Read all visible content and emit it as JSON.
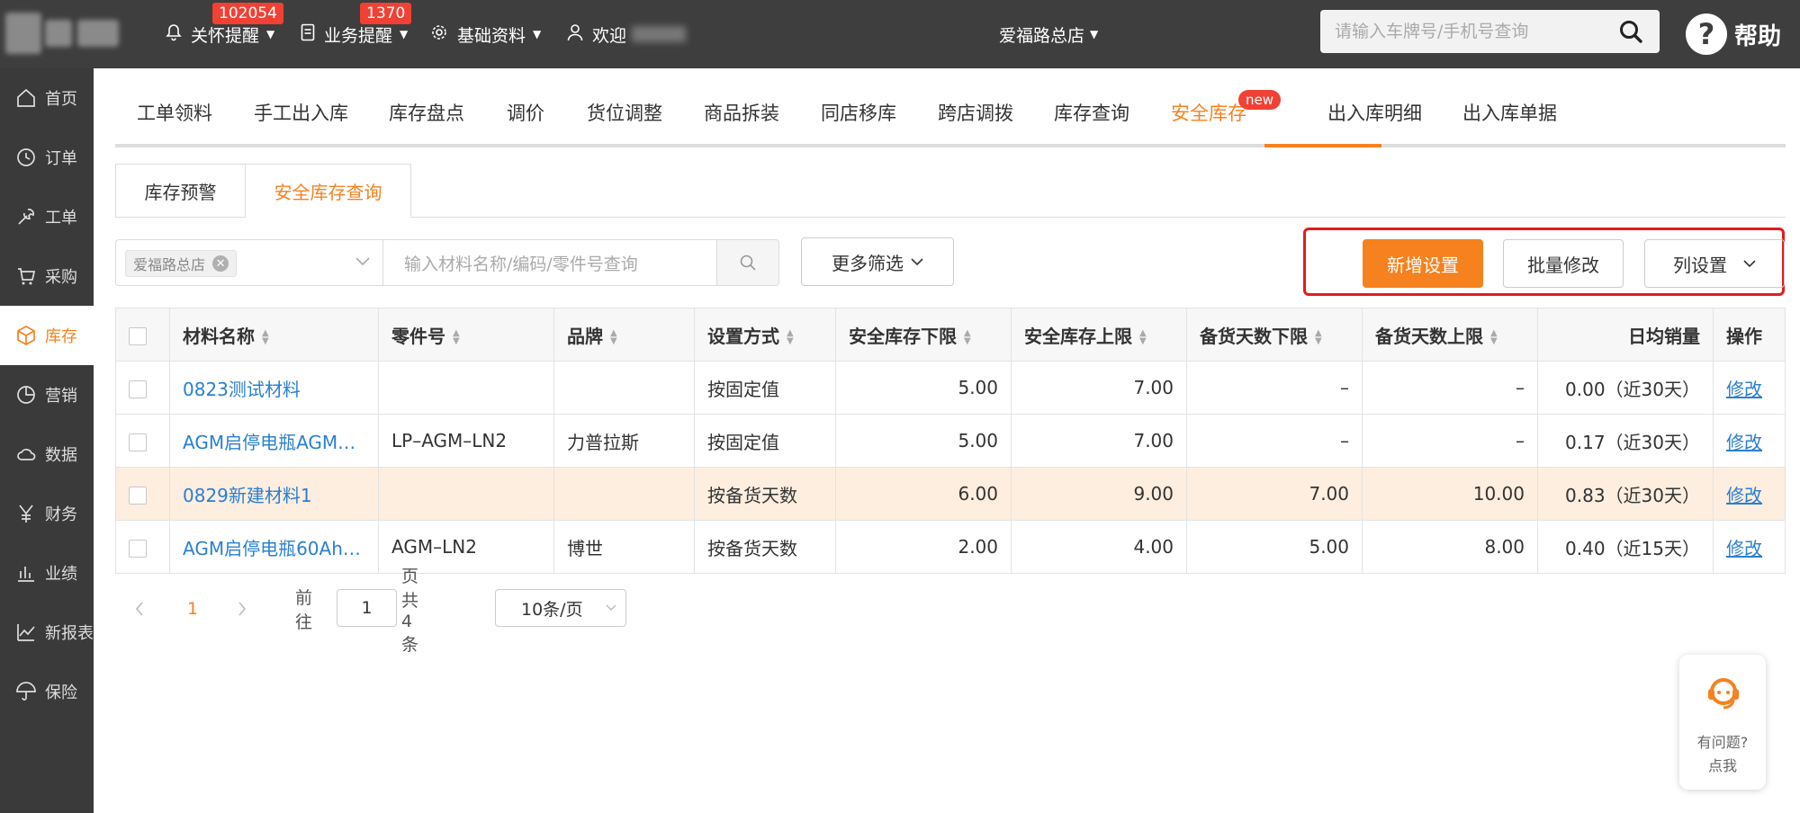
{
  "topbar": {
    "nav": [
      {
        "label": "关怀提醒",
        "badge": "102054"
      },
      {
        "label": "业务提醒",
        "badge": "1370"
      },
      {
        "label": "基础资料",
        "badge": ""
      },
      {
        "label": "欢迎",
        "badge": ""
      }
    ],
    "store": "爱福路总店",
    "search_placeholder": "请输入车牌号/手机号查询",
    "help": "帮助"
  },
  "sidebar": {
    "items": [
      {
        "label": "首页",
        "icon": "home-icon"
      },
      {
        "label": "订单",
        "icon": "clock-icon"
      },
      {
        "label": "工单",
        "icon": "wrench-icon"
      },
      {
        "label": "采购",
        "icon": "cart-icon"
      },
      {
        "label": "库存",
        "icon": "cube-icon"
      },
      {
        "label": "营销",
        "icon": "pie-icon"
      },
      {
        "label": "数据",
        "icon": "cloud-icon"
      },
      {
        "label": "财务",
        "icon": "yen-icon"
      },
      {
        "label": "业绩",
        "icon": "bar-chart-icon"
      },
      {
        "label": "新报表",
        "icon": "line-chart-icon"
      },
      {
        "label": "保险",
        "icon": "umbrella-icon"
      }
    ],
    "active": "库存"
  },
  "tabs": [
    "工单领料",
    "手工出入库",
    "库存盘点",
    "调价",
    "货位调整",
    "商品拆装",
    "同店移库",
    "跨店调拨",
    "库存查询",
    "安全库存",
    "出入库明细",
    "出入库单据"
  ],
  "tab_active": "安全库存",
  "tab_new_badge": "new",
  "subtabs": [
    "库存预警",
    "安全库存查询"
  ],
  "filters": {
    "store_tag": "爱福路总店",
    "material_placeholder": "输入材料名称/编码/零件号查询",
    "more": "更多筛选"
  },
  "actions": {
    "add": "新增设置",
    "batch": "批量修改",
    "columns": "列设置"
  },
  "table": {
    "headers": [
      "材料名称",
      "零件号",
      "品牌",
      "设置方式",
      "安全库存下限",
      "安全库存上限",
      "备货天数下限",
      "备货天数上限",
      "日均销量",
      "操作"
    ],
    "rows": [
      [
        "0823测试材料",
        "",
        "",
        "按固定值",
        "5.00",
        "7.00",
        "–",
        "–",
        "0.00（近30天）",
        "修改"
      ],
      [
        "AGM启停电瓶AGM…",
        "LP–AGM–LN2",
        "力普拉斯",
        "按固定值",
        "5.00",
        "7.00",
        "–",
        "–",
        "0.17（近30天）",
        "修改"
      ],
      [
        "0829新建材料1",
        "",
        "",
        "按备货天数",
        "6.00",
        "9.00",
        "7.00",
        "10.00",
        "0.83（近30天）",
        "修改"
      ],
      [
        "AGM启停电瓶60Ah…",
        "AGM–LN2",
        "博世",
        "按备货天数",
        "2.00",
        "4.00",
        "5.00",
        "8.00",
        "0.40（近15天）",
        "修改"
      ]
    ]
  },
  "pagination": {
    "current": "1",
    "goto_label": "前往",
    "goto_value": "1",
    "total_text": "页共 4 条",
    "page_size": "10条/页"
  },
  "float_help": {
    "line1": "有问题?",
    "line2": "点我"
  },
  "colors": {
    "accent": "#f5821f",
    "link": "#2a7fd0",
    "highlight_row": "#fdeedf",
    "badge": "#f04134"
  }
}
